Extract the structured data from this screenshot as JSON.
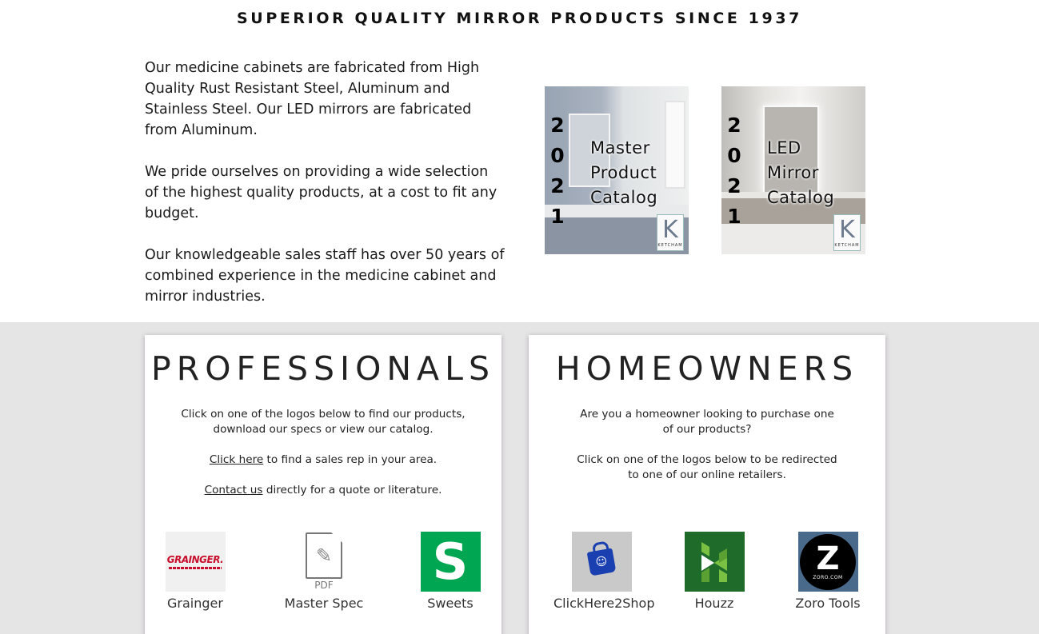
{
  "tagline": "SUPERIOR QUALITY MIRROR PRODUCTS SINCE 1937",
  "intro": {
    "p1": "Our medicine cabinets are fabricated from High Quality Rust Resistant Steel, Aluminum and Stainless Steel. Our LED mirrors are fabricated from Aluminum.",
    "p2": "We pride ourselves on providing a wide selection of the highest quality products, at a cost to fit any budget.",
    "p3": "Our knowledgeable sales staff has over 50 years of combined experience in the medicine cabinet and mirror industries."
  },
  "catalogs": [
    {
      "year": [
        "2",
        "0",
        "2",
        "1"
      ],
      "title_lines": [
        "Master",
        "Product",
        "Catalog"
      ],
      "logo_text": "KETCHAM"
    },
    {
      "year": [
        "2",
        "0",
        "2",
        "1"
      ],
      "title_lines": [
        "LED",
        "Mirror",
        "Catalog"
      ],
      "logo_text": "KETCHAM"
    }
  ],
  "professionals": {
    "title": "PROFESSIONALS",
    "line1a": "Click on one of the logos below to find our products,",
    "line1b": "download our specs or view our catalog.",
    "click_here": "Click here",
    "rep_rest": " to find a sales rep in your area.",
    "contact_us": "Contact us",
    "contact_rest": " directly for a quote or literature.",
    "logos": [
      {
        "label": "Grainger",
        "logo_text": "GRAINGER."
      },
      {
        "label": "Master Spec",
        "logo_text": "PDF"
      },
      {
        "label": "Sweets",
        "logo_text": "S"
      }
    ]
  },
  "homeowners": {
    "title": "HOMEOWNERS",
    "line1a": "Are you a homeowner looking to purchase one",
    "line1b": "of our products?",
    "line2a": "Click on one of the logos below to be redirected",
    "line2b": "to one of our online retailers.",
    "logos": [
      {
        "label": "ClickHere2Shop"
      },
      {
        "label": "Houzz"
      },
      {
        "label": "Zoro Tools",
        "logo_text": "Z",
        "logo_sub": "ZORO.COM"
      }
    ]
  },
  "colors": {
    "grainger_red": "#c8102e",
    "sweets_green": "#00a651",
    "houzz_green": "#1f6b2a",
    "band_grey": "#e6e5e6"
  }
}
